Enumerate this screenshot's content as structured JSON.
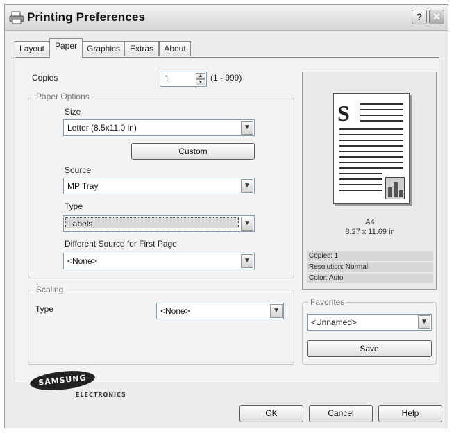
{
  "window": {
    "title": "Printing Preferences",
    "help_label": "?",
    "close_label": "✕"
  },
  "tabs": [
    {
      "label": "Layout",
      "active": false
    },
    {
      "label": "Paper",
      "active": true
    },
    {
      "label": "Graphics",
      "active": false
    },
    {
      "label": "Extras",
      "active": false
    },
    {
      "label": "About",
      "active": false
    }
  ],
  "copies": {
    "label": "Copies",
    "value": "1",
    "range": "(1 - 999)"
  },
  "paper_options": {
    "legend": "Paper Options",
    "size_label": "Size",
    "size_value": "Letter (8.5x11.0 in)",
    "custom_button": "Custom",
    "source_label": "Source",
    "source_value": "MP Tray",
    "type_label": "Type",
    "type_value": "Labels",
    "diff_source_label": "Different Source for First Page",
    "diff_source_value": "<None>"
  },
  "scaling": {
    "legend": "Scaling",
    "type_label": "Type",
    "type_value": "<None>"
  },
  "preview": {
    "page_letter": "S",
    "paper_name": "A4",
    "paper_dims": "8.27 x 11.69 in",
    "info": [
      "Copies: 1",
      "Resolution: Normal",
      "Color: Auto"
    ]
  },
  "favorites": {
    "legend": "Favorites",
    "value": "<Unnamed>",
    "save_button": "Save"
  },
  "brand": {
    "logo": "SAMSUNG",
    "sub": "ELECTRONICS"
  },
  "buttons": {
    "ok": "OK",
    "cancel": "Cancel",
    "help": "Help"
  },
  "icons": {
    "title": "printer-icon",
    "dropdown": "chevron-down-icon"
  }
}
